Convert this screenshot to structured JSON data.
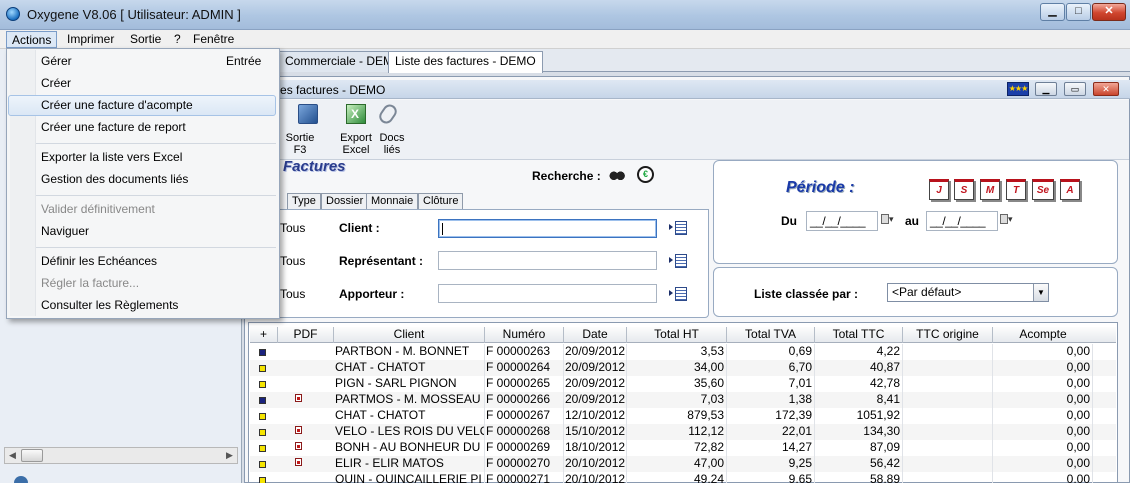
{
  "window": {
    "title": "Oxygene V8.06 [ Utilisateur: ADMIN ]",
    "minimize": "▁",
    "maximize": "□",
    "close": "✕"
  },
  "menubar": [
    "Actions",
    "Imprimer",
    "Sortie",
    "?",
    "Fenêtre"
  ],
  "actions_menu": {
    "items": [
      {
        "label": "Gérer",
        "shortcut": "Entrée",
        "disabled": false
      },
      {
        "label": "Créer",
        "disabled": false
      },
      {
        "label": "Créer une facture d'acompte",
        "disabled": false,
        "hover": true
      },
      {
        "label": "Créer une facture de report",
        "disabled": false
      },
      {
        "label": "Exporter la liste vers Excel",
        "disabled": false
      },
      {
        "label": "Gestion des documents liés",
        "disabled": false
      },
      {
        "label": "Valider définitivement",
        "disabled": true
      },
      {
        "label": "Naviguer",
        "disabled": false
      },
      {
        "label": "Définir les Echéances",
        "disabled": false
      },
      {
        "label": "Régler la facture...",
        "disabled": true
      },
      {
        "label": "Consulter les Règlements",
        "disabled": false
      }
    ]
  },
  "tabs": [
    "Commerciale - DEMO",
    "Liste des factures - DEMO"
  ],
  "inner_window": {
    "title": "te des factures - DEMO",
    "flag": "★★★"
  },
  "toolbar": [
    {
      "label": "Sortie\nF3",
      "icon": "exit-icon"
    },
    {
      "label": "Export\nExcel",
      "icon": "excel-icon"
    },
    {
      "label": "Docs\nliés",
      "icon": "paperclip-icon"
    }
  ],
  "section_title": "Factures",
  "search": {
    "label": "Recherche :",
    "subtabs": [
      "Type",
      "Dossier",
      "Monnaie",
      "Clôture"
    ],
    "fields": [
      {
        "tous": "Tous",
        "label": "Client :",
        "value": ""
      },
      {
        "tous": "Tous",
        "label": "Représentant :",
        "value": ""
      },
      {
        "tous": "Tous",
        "label": "Apporteur :",
        "value": ""
      }
    ]
  },
  "periode": {
    "label": "Période :",
    "buttons": [
      "J",
      "S",
      "M",
      "T",
      "Se",
      "A"
    ],
    "du_label": "Du",
    "au_label": "au",
    "du_value": "__/__/____",
    "au_value": "__/__/____"
  },
  "sort": {
    "label": "Liste classée par :",
    "value": "<Par défaut>"
  },
  "grid": {
    "corner": "+",
    "columns": [
      "PDF",
      "Client",
      "Numéro",
      "Date",
      "Total HT",
      "Total TVA",
      "Total TTC",
      "TTC origine",
      "Acompte"
    ],
    "rows": [
      {
        "color": "#1a237e",
        "pdf": false,
        "client": "PARTBON - M. BONNET",
        "numero": "F 00000263",
        "date": "20/09/2012",
        "ht": "3,53",
        "tva": "0,69",
        "ttc": "4,22",
        "origine": "",
        "acompte": "0,00"
      },
      {
        "color": "#f5e400",
        "pdf": false,
        "client": "CHAT - CHATOT",
        "numero": "F 00000264",
        "date": "20/09/2012",
        "ht": "34,00",
        "tva": "6,70",
        "ttc": "40,87",
        "origine": "",
        "acompte": "0,00"
      },
      {
        "color": "#f5e400",
        "pdf": false,
        "client": "PIGN - SARL PIGNON",
        "numero": "F 00000265",
        "date": "20/09/2012",
        "ht": "35,60",
        "tva": "7,01",
        "ttc": "42,78",
        "origine": "",
        "acompte": "0,00"
      },
      {
        "color": "#1a237e",
        "pdf": true,
        "client": "PARTMOS - M. MOSSEAU EI",
        "numero": "F 00000266",
        "date": "20/09/2012",
        "ht": "7,03",
        "tva": "1,38",
        "ttc": "8,41",
        "origine": "",
        "acompte": "0,00"
      },
      {
        "color": "#f5e400",
        "pdf": false,
        "client": "CHAT - CHATOT",
        "numero": "F 00000267",
        "date": "12/10/2012",
        "ht": "879,53",
        "tva": "172,39",
        "ttc": "1051,92",
        "origine": "",
        "acompte": "0,00"
      },
      {
        "color": "#f5e400",
        "pdf": true,
        "client": "VELO - LES ROIS DU VELO",
        "numero": "F 00000268",
        "date": "15/10/2012",
        "ht": "112,12",
        "tva": "22,01",
        "ttc": "134,30",
        "origine": "",
        "acompte": "0,00"
      },
      {
        "color": "#f5e400",
        "pdf": true,
        "client": "BONH - AU BONHEUR DU F",
        "numero": "F 00000269",
        "date": "18/10/2012",
        "ht": "72,82",
        "tva": "14,27",
        "ttc": "87,09",
        "origine": "",
        "acompte": "0,00"
      },
      {
        "color": "#f5e400",
        "pdf": true,
        "client": "ELIR - ELIR MATOS",
        "numero": "F 00000270",
        "date": "20/10/2012",
        "ht": "47,00",
        "tva": "9,25",
        "ttc": "56,42",
        "origine": "",
        "acompte": "0,00"
      },
      {
        "color": "#f5e400",
        "pdf": false,
        "client": "QUIN - QUINCAILLERIE PI",
        "numero": "F 00000271",
        "date": "20/10/2012",
        "ht": "49,24",
        "tva": "9,65",
        "ttc": "58,89",
        "origine": "",
        "acompte": "0,00"
      }
    ]
  }
}
